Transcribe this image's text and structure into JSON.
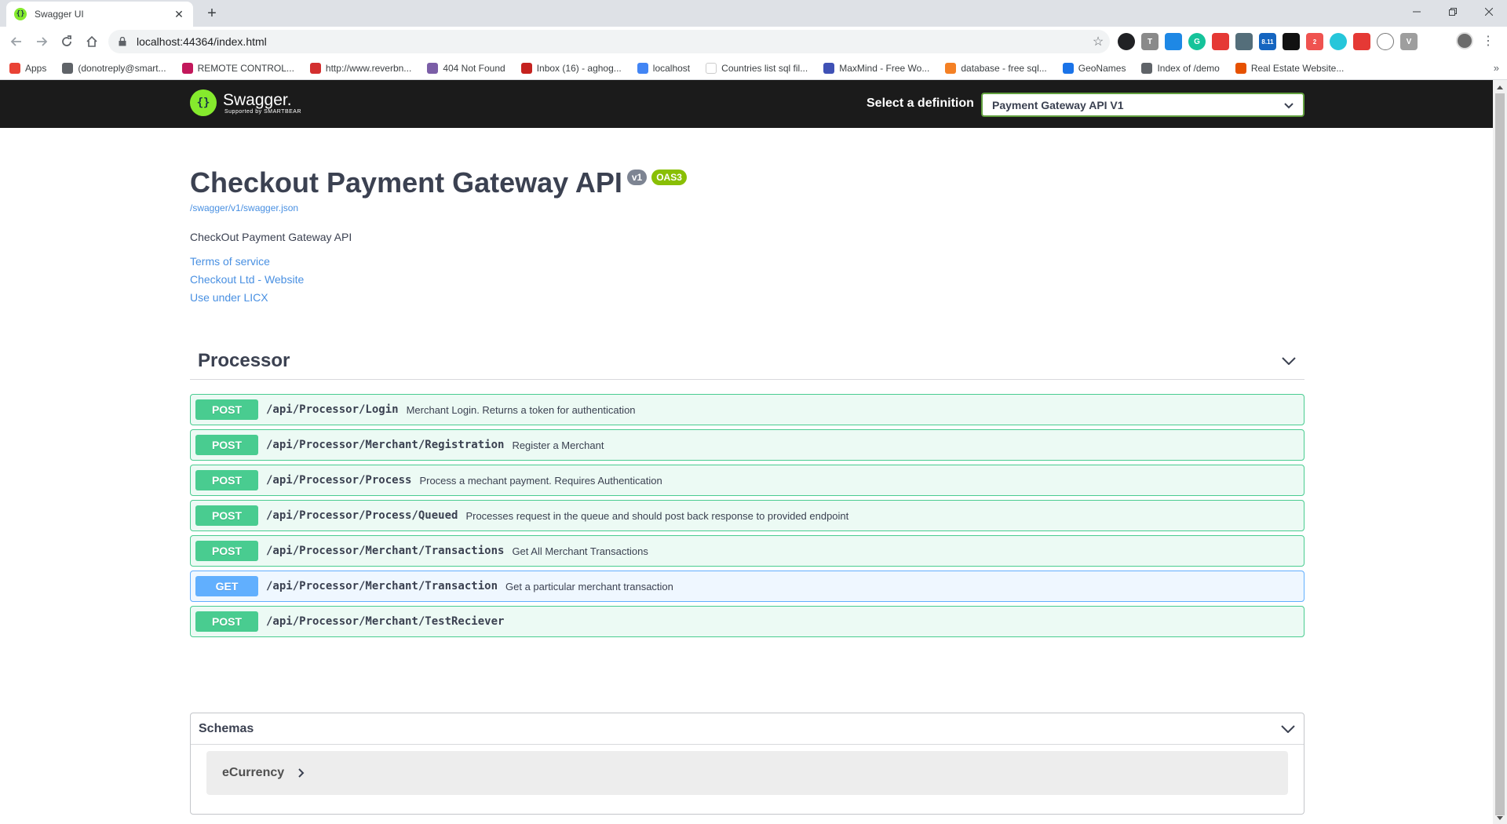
{
  "browser": {
    "tab_title": "Swagger UI",
    "url": "localhost:44364/index.html",
    "bookmarks": [
      {
        "label": "Apps",
        "color": "#e94235"
      },
      {
        "label": "(donotreply@smart...",
        "color": "#5f6368"
      },
      {
        "label": "REMOTE CONTROL...",
        "color": "#c2185b"
      },
      {
        "label": "http://www.reverbn...",
        "color": "#d32f2f"
      },
      {
        "label": "404 Not Found",
        "color": "#7b5ea7"
      },
      {
        "label": "Inbox (16) - aghog...",
        "color": "#c5221f"
      },
      {
        "label": "localhost",
        "color": "#4285f4"
      },
      {
        "label": "Countries list sql fil...",
        "color": "#ffffff"
      },
      {
        "label": "MaxMind - Free Wo...",
        "color": "#3f51b5"
      },
      {
        "label": "database - free sql...",
        "color": "#f48024"
      },
      {
        "label": "GeoNames",
        "color": "#1a73e8"
      },
      {
        "label": "Index of /demo",
        "color": "#5f6368"
      },
      {
        "label": "Real Estate Website...",
        "color": "#e65100"
      }
    ],
    "extension_badges": {
      "first": "8.11",
      "second": "2"
    }
  },
  "topbar": {
    "logo_text": "Swagger.",
    "logo_sub": "Supported by SMARTBEAR",
    "definition_label": "Select a definition",
    "definition_value": "Payment Gateway API V1"
  },
  "info": {
    "title": "Checkout Payment Gateway API",
    "version_badge": "v1",
    "oas_badge": "OAS3",
    "json_link": "/swagger/v1/swagger.json",
    "description": "CheckOut Payment Gateway API",
    "links": {
      "terms": "Terms of service",
      "contact": "Checkout Ltd - Website",
      "license": "Use under LICX"
    }
  },
  "tag": {
    "name": "Processor"
  },
  "operations": [
    {
      "method": "POST",
      "path": "/api/Processor/Login",
      "summary": "Merchant Login. Returns a token for authentication"
    },
    {
      "method": "POST",
      "path": "/api/Processor/Merchant/Registration",
      "summary": "Register a Merchant"
    },
    {
      "method": "POST",
      "path": "/api/Processor/Process",
      "summary": "Process a mechant payment. Requires Authentication"
    },
    {
      "method": "POST",
      "path": "/api/Processor/Process/Queued",
      "summary": "Processes request in the queue and should post back response to provided endpoint"
    },
    {
      "method": "POST",
      "path": "/api/Processor/Merchant/Transactions",
      "summary": "Get All Merchant Transactions"
    },
    {
      "method": "GET",
      "path": "/api/Processor/Merchant/Transaction",
      "summary": "Get a particular merchant transaction"
    },
    {
      "method": "POST",
      "path": "/api/Processor/Merchant/TestReciever",
      "summary": ""
    }
  ],
  "schemas": {
    "title": "Schemas",
    "models": [
      {
        "name": "eCurrency"
      }
    ]
  },
  "colors": {
    "post": "#49cc90",
    "get": "#61affe",
    "topbar": "#1b1b1b",
    "link": "#4990e2",
    "swagger_green": "#85ea2d"
  }
}
